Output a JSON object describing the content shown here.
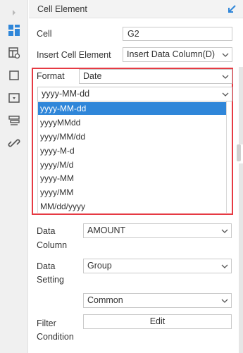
{
  "header": {
    "title": "Cell Element"
  },
  "rail": {
    "icons": [
      "expand-arrow-icon",
      "cell-element-icon",
      "cell-attribute-icon",
      "border-icon",
      "widget-icon",
      "condition-attribute-icon",
      "hyperlink-icon"
    ],
    "active": "cell-element-icon",
    "accent": "#2f86d9"
  },
  "form": {
    "cell_label": "Cell",
    "cell_value": "G2",
    "insert_label": "Insert Cell Element",
    "insert_value": "Insert Data Column(D)",
    "format_label": "Format",
    "format_value": "Date",
    "date_pattern_value": "yyyy-MM-dd",
    "date_patterns": [
      "yyyy-MM-dd",
      "yyyyMMdd",
      "yyyy/MM/dd",
      "yyyy-M-d",
      "yyyy/M/d",
      "yyyy-MM",
      "yyyy/MM",
      "MM/dd/yyyy"
    ],
    "date_patterns_selected_index": 0,
    "data_column_label_1": "Data",
    "data_column_label_2": "Column",
    "data_column_value": "AMOUNT",
    "data_setting_label_1": "Data",
    "data_setting_label_2": "Setting",
    "data_setting_value": "Group",
    "data_setting_mode": "Common",
    "filter_label_1": "Filter",
    "filter_label_2": "Condition",
    "edit_button_label": "Edit"
  },
  "colors": {
    "highlight_border": "#e63a43",
    "selected_bg": "#2f86d9"
  }
}
